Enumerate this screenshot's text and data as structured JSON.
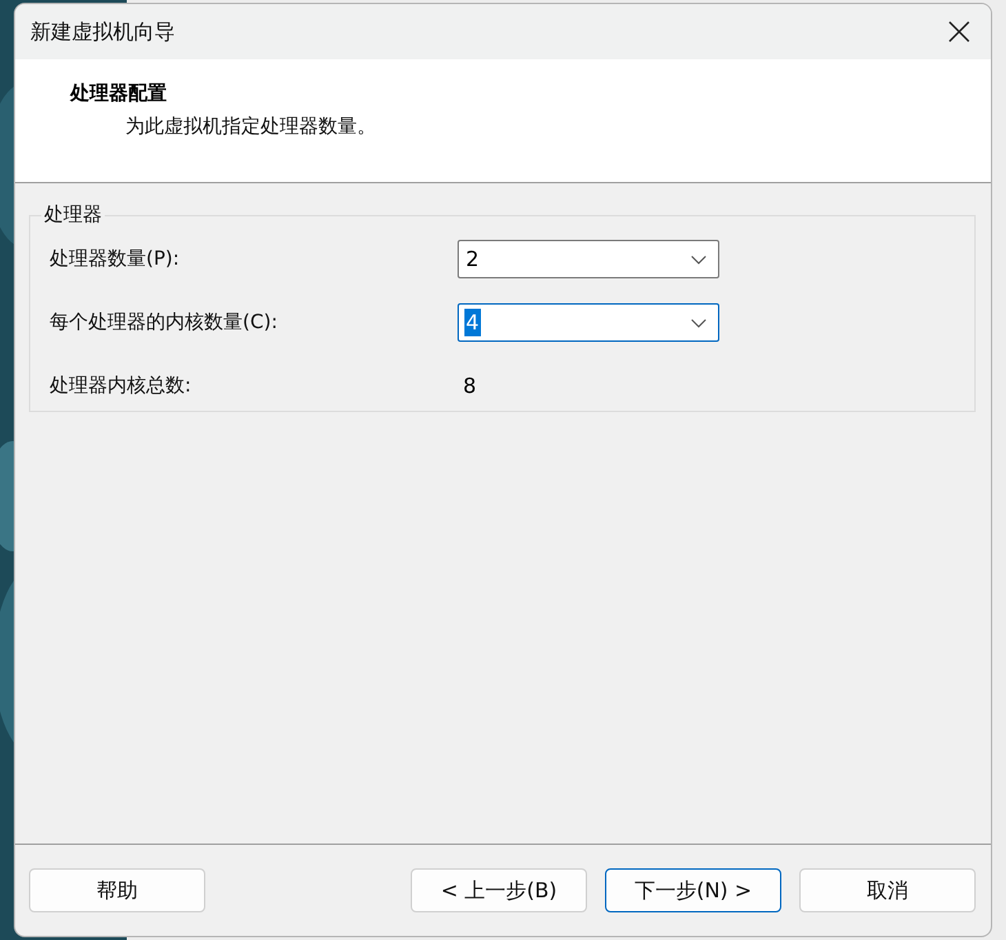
{
  "window": {
    "title": "新建虚拟机向导"
  },
  "header": {
    "title": "处理器配置",
    "subtitle": "为此虚拟机指定处理器数量。"
  },
  "group": {
    "label": "处理器",
    "fields": [
      {
        "kind": "combo",
        "label": "处理器数量(P):",
        "value": "2",
        "focused": false
      },
      {
        "kind": "combo",
        "label": "每个处理器的内核数量(C):",
        "value": "4",
        "focused": true
      },
      {
        "kind": "readout",
        "label": "处理器内核总数:",
        "value": "8"
      }
    ]
  },
  "buttons": [
    {
      "label": "帮助",
      "default": false
    },
    {
      "label": "< 上一步(B)",
      "default": false
    },
    {
      "label": "下一步(N) >",
      "default": true
    },
    {
      "label": "取消",
      "default": false
    }
  ]
}
